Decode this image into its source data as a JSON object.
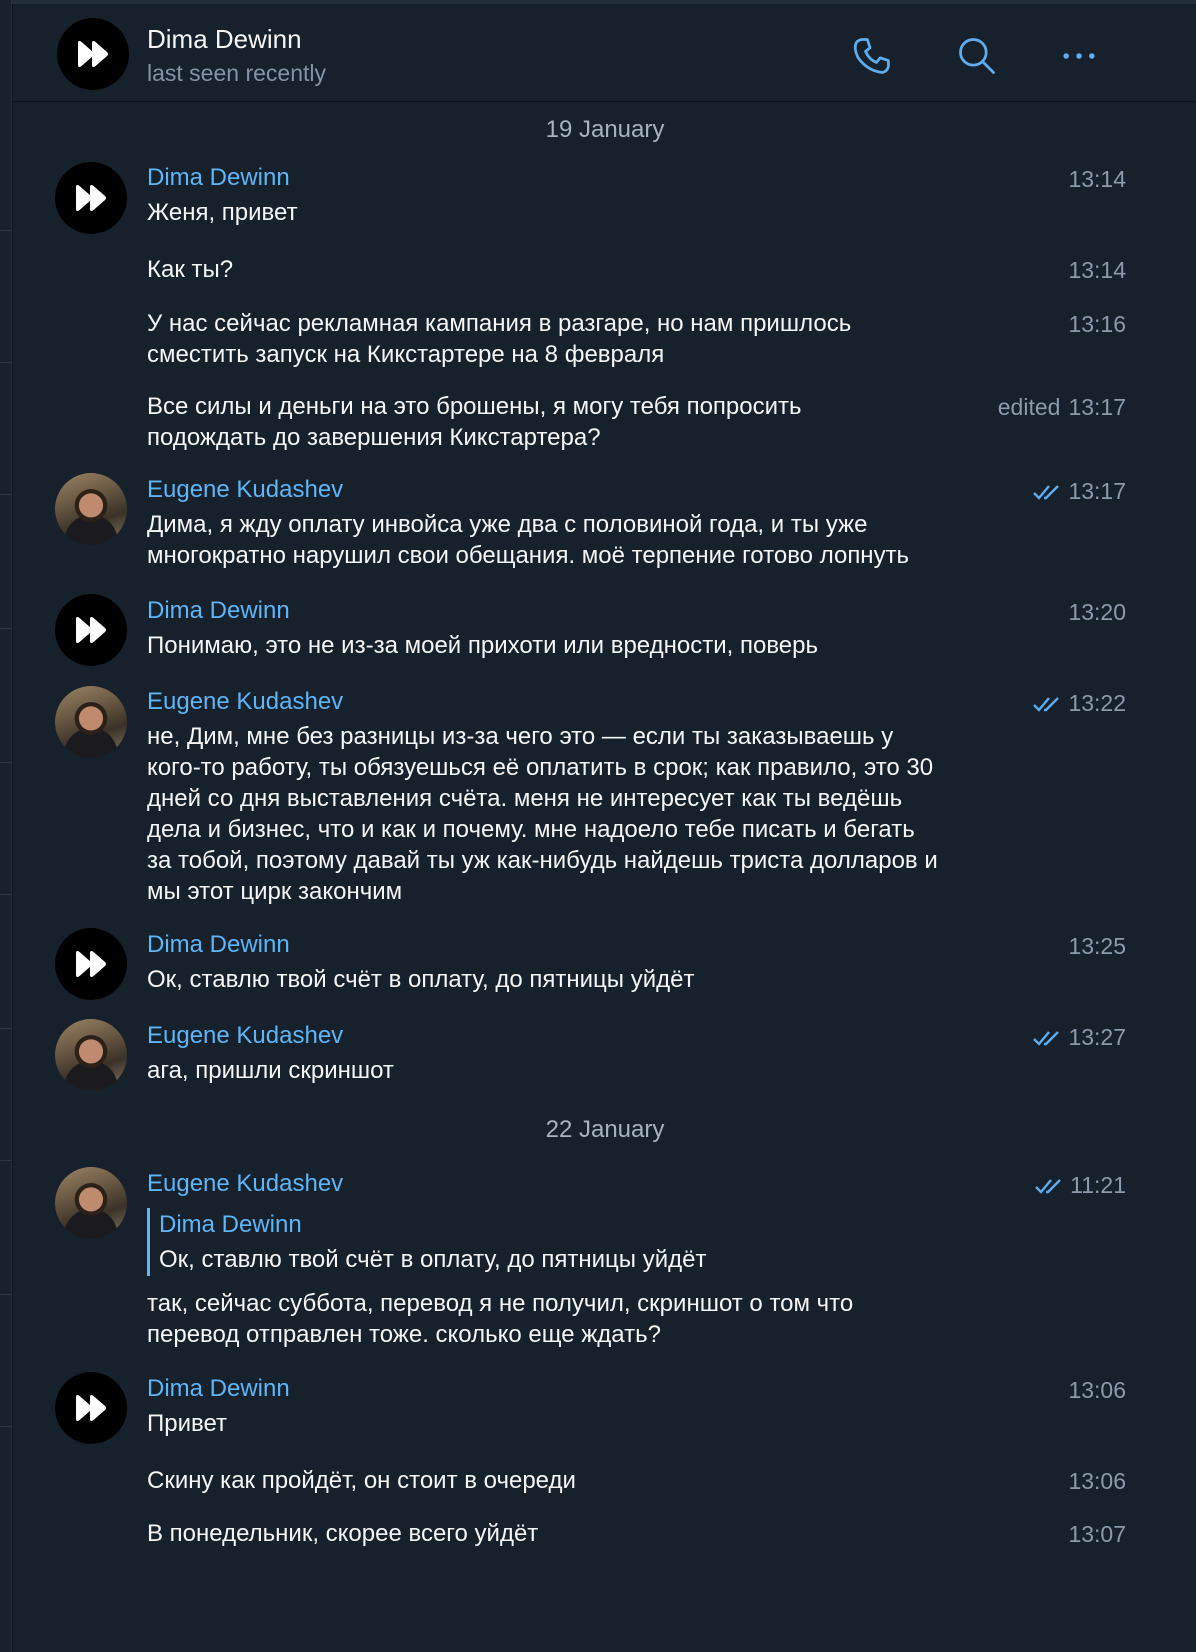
{
  "header": {
    "title": "Dima Dewinn",
    "status": "last seen recently",
    "icons": [
      "phone-icon",
      "search-icon",
      "more-icon"
    ]
  },
  "colors": {
    "accent": "#5eb5f7",
    "background": "#17212b",
    "muted": "#8b9bab"
  },
  "dates": [
    "19 January",
    "22 January"
  ],
  "messages": [
    {
      "sender": "Dima Dewinn",
      "text": "Женя, привет",
      "time": "13:14"
    },
    {
      "text": "Как ты?",
      "time": "13:14"
    },
    {
      "text": "У нас сейчас рекламная кампания в разгаре, но нам пришлось\nсместить запуск на Кикстартере на 8 февраля",
      "time": "13:16"
    },
    {
      "text": "Все силы и деньги на это брошены, я могу тебя попросить\nподождать до завершения Кикстартера?",
      "time": "13:17",
      "edited": "edited"
    },
    {
      "sender": "Eugene Kudashev",
      "text": "Дима, я жду оплату инвойса уже два с половиной года, и ты уже\nмногократно нарушил свои обещания. моё терпение готово лопнуть",
      "time": "13:17",
      "read": true
    },
    {
      "sender": "Dima Dewinn",
      "text": "Понимаю, это не из-за моей прихоти или вредности, поверь",
      "time": "13:20"
    },
    {
      "sender": "Eugene Kudashev",
      "text": "не, Дим, мне без разницы из-за чего это — если ты заказываешь у\nкого-то работу, ты обязуешься её оплатить в срок; как правило, это 30\nдней со дня выставления счёта. меня не интересует как ты ведёшь\nдела и бизнес, что и как и почему. мне надоело тебе писать и бегать\nза тобой, поэтому давай ты уж как-нибудь найдешь триста долларов и\nмы этот цирк закончим",
      "time": "13:22",
      "read": true
    },
    {
      "sender": "Dima Dewinn",
      "text": "Ок, ставлю твой счёт в оплату, до пятницы уйдёт",
      "time": "13:25"
    },
    {
      "sender": "Eugene Kudashev",
      "text": "ага, пришли скриншот",
      "time": "13:27",
      "read": true
    },
    {
      "sender": "Eugene Kudashev",
      "reply_to": {
        "name": "Dima Dewinn",
        "text": "Ок, ставлю твой счёт в оплату, до пятницы уйдёт"
      },
      "text": "так, сейчас суббота, перевод я не получил, скриншот о том что\nперевод отправлен тоже. сколько еще ждать?",
      "time": "11:21",
      "read": true
    },
    {
      "sender": "Dima Dewinn",
      "text": "Привет",
      "time": "13:06"
    },
    {
      "text": "Скину как пройдёт, он стоит в очереди",
      "time": "13:06"
    },
    {
      "text": "В понедельник, скорее всего уйдёт",
      "time": "13:07"
    }
  ]
}
